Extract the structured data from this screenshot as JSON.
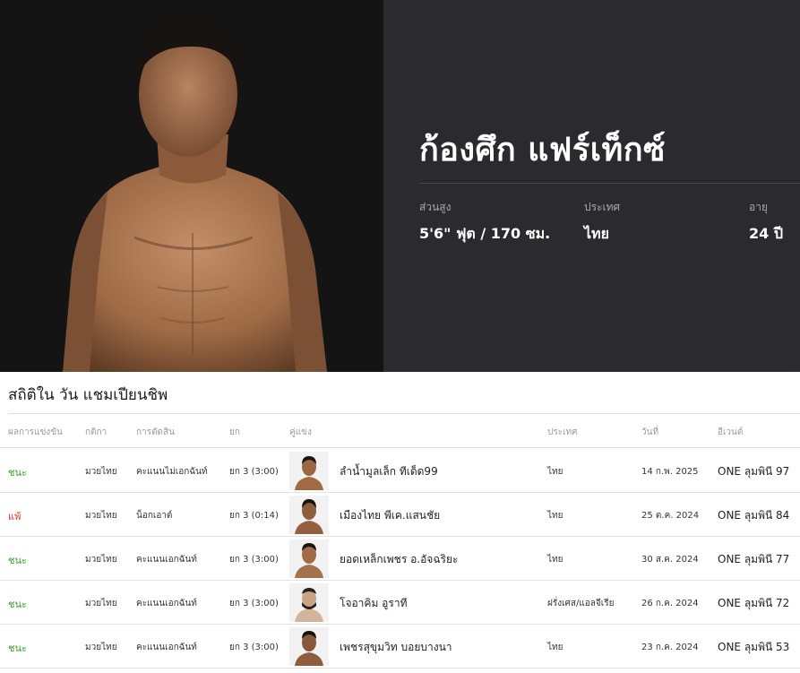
{
  "fighter": {
    "name": "ก้องศึก แฟร์เท็กซ์",
    "stats": [
      {
        "label": "ส่วนสูง",
        "value": "5'6\" ฟุต / 170 ซม."
      },
      {
        "label": "ประเทศ",
        "value": "ไทย"
      },
      {
        "label": "อายุ",
        "value": "24 ปี"
      }
    ]
  },
  "record": {
    "title": "สถิติใน วัน แชมเปียนชิพ",
    "columns": [
      "ผลการแข่งขัน",
      "กติกา",
      "การตัดสิน",
      "ยก",
      "คู่แข่ง",
      "ประเทศ",
      "วันที่",
      "อีเวนต์"
    ],
    "rows": [
      {
        "result": "ชนะ",
        "result_type": "win",
        "sport": "มวยไทย",
        "method": "คะแนนไม่เอกฉันท์",
        "round": "ยก 3 (3:00)",
        "opponent": "ลำน้ำมูลเล็ก ทีเด็ด99",
        "country": "ไทย",
        "date": "14 ก.พ. 2025",
        "event": "ONE ลุมพินี 97"
      },
      {
        "result": "แพ้",
        "result_type": "loss",
        "sport": "มวยไทย",
        "method": "น็อกเอาต์",
        "round": "ยก 3 (0:14)",
        "opponent": "เมืองไทย พีเค.แสนชัย",
        "country": "ไทย",
        "date": "25 ต.ค. 2024",
        "event": "ONE ลุมพินี 84"
      },
      {
        "result": "ชนะ",
        "result_type": "win",
        "sport": "มวยไทย",
        "method": "คะแนนเอกฉันท์",
        "round": "ยก 3 (3:00)",
        "opponent": "ยอดเหล็กเพชร อ.อัจฉริยะ",
        "country": "ไทย",
        "date": "30 ส.ค. 2024",
        "event": "ONE ลุมพินี 77"
      },
      {
        "result": "ชนะ",
        "result_type": "win",
        "sport": "มวยไทย",
        "method": "คะแนนเอกฉันท์",
        "round": "ยก 3 (3:00)",
        "opponent": "โจอาคิม อูราที",
        "country": "ฝรั่งเศส/แอลจีเรีย",
        "date": "26 ก.ค. 2024",
        "event": "ONE ลุมพินี 72"
      },
      {
        "result": "ชนะ",
        "result_type": "win",
        "sport": "มวยไทย",
        "method": "คะแนนเอกฉันท์",
        "round": "ยก 3 (3:00)",
        "opponent": "เพชรสุขุมวิท บอยบางนา",
        "country": "ไทย",
        "date": "23 ก.ค. 2024",
        "event": "ONE ลุมพินี 53"
      }
    ]
  },
  "colors": {
    "win": "#35a12c",
    "loss": "#e0342d",
    "hero_panel": "#2b2b2f"
  }
}
